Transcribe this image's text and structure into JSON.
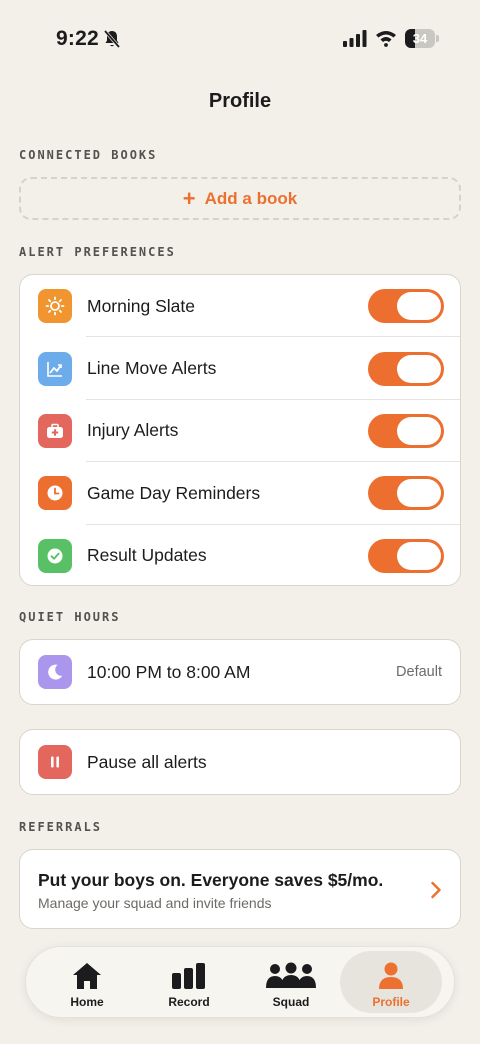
{
  "status_bar": {
    "time": "9:22",
    "battery": "34",
    "battery_level": 0.34
  },
  "page_title": "Profile",
  "sections": {
    "connected_books": "CONNECTED BOOKS",
    "alert_preferences": "ALERT PREFERENCES",
    "quiet_hours": "QUIET HOURS",
    "referrals": "REFERRALS"
  },
  "add_book": {
    "icon": "+",
    "label": "Add a book"
  },
  "alerts": [
    {
      "label": "Morning Slate",
      "icon": "sun-icon",
      "color": "#f0952f",
      "enabled": true
    },
    {
      "label": "Line Move Alerts",
      "icon": "chart-line-icon",
      "color": "#6cacea",
      "enabled": true
    },
    {
      "label": "Injury Alerts",
      "icon": "medical-kit-icon",
      "color": "#e4675d",
      "enabled": true
    },
    {
      "label": "Game Day Reminders",
      "icon": "clock-icon",
      "color": "#ec6f2f",
      "enabled": true
    },
    {
      "label": "Result Updates",
      "icon": "check-circle-icon",
      "color": "#5ac066",
      "enabled": true
    }
  ],
  "quiet_hours": {
    "label": "10:00 PM to 8:00 AM",
    "badge": "Default",
    "icon": "moon-icon",
    "color": "#ab96ee"
  },
  "pause": {
    "label": "Pause all alerts",
    "icon": "pause-icon",
    "color": "#e4675d"
  },
  "referral": {
    "title": "Put your boys on. Everyone saves $5/mo.",
    "subtitle": "Manage your squad and invite friends"
  },
  "tab_bar": {
    "tabs": [
      {
        "label": "Home",
        "icon": "home-icon",
        "active": false
      },
      {
        "label": "Record",
        "icon": "bar-chart-icon",
        "active": false
      },
      {
        "label": "Squad",
        "icon": "group-icon",
        "active": false
      },
      {
        "label": "Profile",
        "icon": "person-icon",
        "active": true
      }
    ]
  },
  "colors": {
    "accent": "#ec7030",
    "background": "#f3f0e9",
    "card": "#ffffff",
    "toggle_on": "#ec6f2f"
  }
}
